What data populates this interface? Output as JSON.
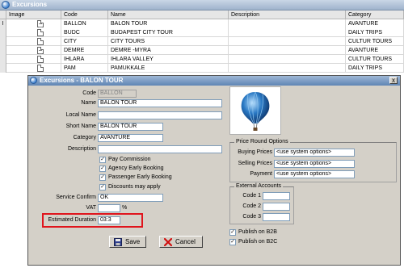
{
  "window": {
    "title": "Excursions"
  },
  "grid": {
    "columns": [
      "Image",
      "Code",
      "Name",
      "Description",
      "Category"
    ],
    "rows": [
      {
        "indicator": "I",
        "code": "BALLON",
        "name": "BALON TOUR",
        "description": "",
        "category": "AVANTURE"
      },
      {
        "indicator": "",
        "code": "BUDC",
        "name": "BUDAPEST CITY TOUR",
        "description": "",
        "category": "DAILY TRIPS"
      },
      {
        "indicator": "",
        "code": "CITY",
        "name": "CITY TOURS",
        "description": "",
        "category": "CULTUR TOURS"
      },
      {
        "indicator": "",
        "code": "DEMRE",
        "name": "DEMRE -MYRA",
        "description": "",
        "category": "AVANTURE"
      },
      {
        "indicator": "",
        "code": "IHLARA",
        "name": "IHLARA VALLEY",
        "description": "",
        "category": "CULTUR TOURS"
      },
      {
        "indicator": "",
        "code": "PAM",
        "name": "PAMUKKALE",
        "description": "",
        "category": "DAILY TRIPS"
      }
    ]
  },
  "dialog": {
    "title": "Excursions - BALON TOUR",
    "close_glyph": "x",
    "labels": {
      "code": "Code",
      "name": "Name",
      "local_name": "Local Name",
      "short_name": "Short Name",
      "category": "Category",
      "description": "Description",
      "service_confirm": "Service Confirm",
      "vat": "VAT",
      "vat_unit": "%",
      "estimated_duration": "Estimated Duration"
    },
    "values": {
      "code": "BALLON",
      "name": "BALON TOUR",
      "local_name": "",
      "short_name": "BALON TOUR",
      "category": "AVANTURE",
      "description": "",
      "service_confirm": "OK",
      "vat": "",
      "estimated_duration": "03:3"
    },
    "checkboxes": [
      {
        "label": "Pay Commission",
        "checked": true
      },
      {
        "label": "Agency Early Booking",
        "checked": true
      },
      {
        "label": "Passenger Early Booking",
        "checked": true
      },
      {
        "label": "Discounts may apply",
        "checked": true
      }
    ],
    "price_round": {
      "title": "Price Round Options",
      "buying_label": "Buying Prices",
      "buying_value": "<use system options>",
      "selling_label": "Selling Prices",
      "selling_value": "<use system options>",
      "payment_label": "Payment",
      "payment_value": "<use system options>"
    },
    "external_accounts": {
      "title": "External Accounts",
      "code1_label": "Code 1",
      "code2_label": "Code 2",
      "code3_label": "Code 3"
    },
    "publish": [
      {
        "label": "Publish on B2B",
        "checked": true
      },
      {
        "label": "Publish on B2C",
        "checked": true
      }
    ],
    "buttons": {
      "save": "Save",
      "cancel": "Cancel"
    },
    "check_glyph": "✓",
    "colors": {
      "highlight": "#e0141c",
      "title_bar": "#5f85b4"
    }
  }
}
